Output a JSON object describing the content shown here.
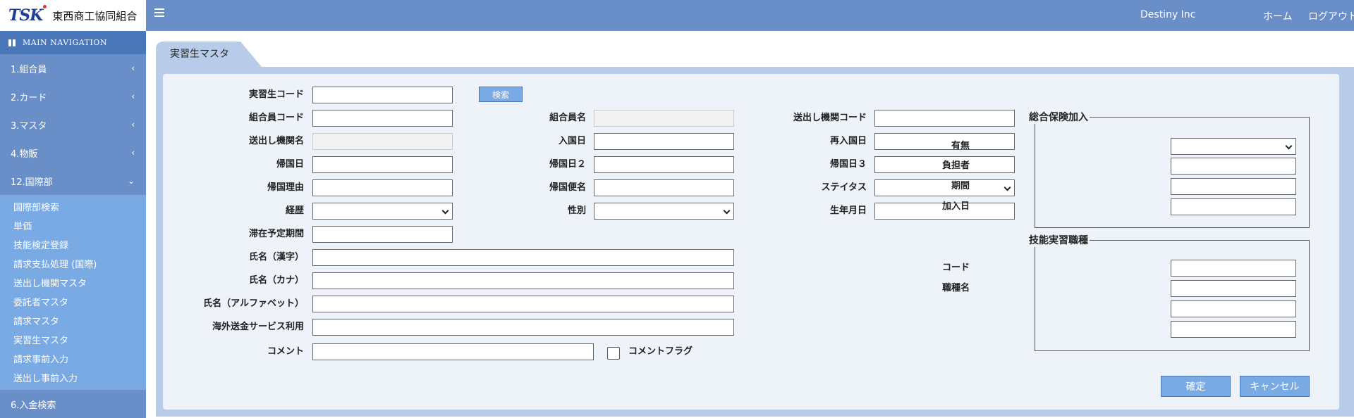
{
  "app": {
    "logo_mark": "TSK",
    "org_name": "東西商工協同組合",
    "company": "Destiny Inc",
    "home": "ホーム",
    "logout": "ログアウト"
  },
  "sidebar": {
    "header": "MAIN NAVIGATION",
    "items": [
      {
        "label": "1.組合員",
        "chevron": "‹"
      },
      {
        "label": "2.カード",
        "chevron": "‹"
      },
      {
        "label": "3.マスタ",
        "chevron": "‹"
      },
      {
        "label": "4.物販",
        "chevron": "‹"
      },
      {
        "label": "12.国際部",
        "chevron": "⌄"
      }
    ],
    "submenu": [
      "国際部検索",
      "単価",
      "技能検定登録",
      "請求支払処理 (国際)",
      "送出し機関マスタ",
      "委託者マスタ",
      "請求マスタ",
      "実習生マスタ",
      "請求事前入力",
      "送出し事前入力"
    ],
    "last_item": "6.入金検索"
  },
  "tab": {
    "title": "実習生マスタ"
  },
  "form": {
    "trainee_code": "実習生コード",
    "search_button": "検索",
    "member_code": "組合員コード",
    "member_name": "組合員名",
    "sending_org_code": "送出し機関コード",
    "sending_org_name": "送出し機関名",
    "entry_date": "入国日",
    "reentry_date": "再入国日",
    "return_date": "帰国日",
    "return_date2": "帰国日２",
    "return_date3": "帰国日３",
    "return_reason": "帰国理由",
    "return_flight": "帰国便名",
    "status": "ステイタス",
    "history": "経歴",
    "gender": "性別",
    "birth_date": "生年月日",
    "stay_period": "滞在予定期間",
    "name_kanji": "氏名（漢字）",
    "name_kana": "氏名（カナ）",
    "name_alpha": "氏名（アルファベット）",
    "overseas_remit": "海外送金サービス利用",
    "comment": "コメント",
    "comment_flag": "コメントフラグ"
  },
  "insurance": {
    "legend": "総合保険加入",
    "presence": "有無",
    "payer": "負担者",
    "period": "期間",
    "join_date": "加入日"
  },
  "occupation": {
    "legend": "技能実習職種",
    "code": "コード",
    "name": "職種名"
  },
  "actions": {
    "ok": "確定",
    "cancel": "キャンセル"
  }
}
